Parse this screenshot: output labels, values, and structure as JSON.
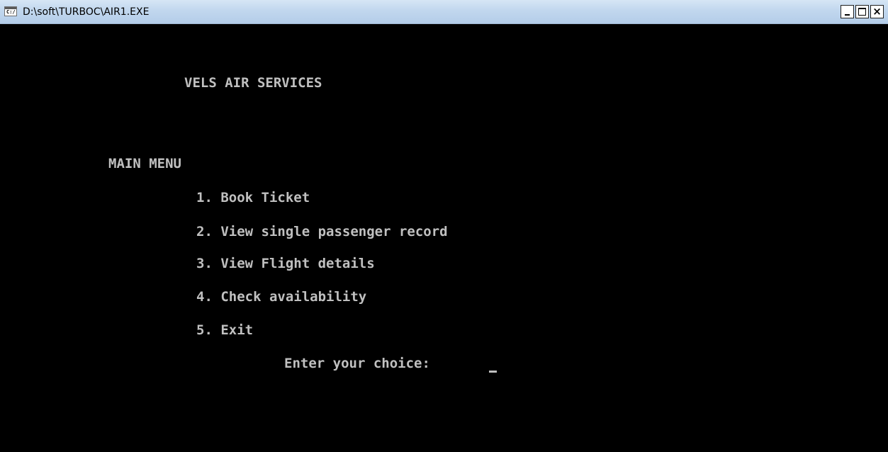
{
  "window": {
    "title": "D:\\soft\\TURBOC\\AIR1.EXE",
    "icon": "console-icon",
    "controls": {
      "minimize": "minimize-icon",
      "maximize": "maximize-icon",
      "close": "close-icon",
      "close_glyph": "×"
    }
  },
  "console": {
    "heading": "VELS AIR SERVICES",
    "menu_title": "MAIN MENU",
    "menu_items": [
      "1. Book Ticket",
      "2. View single passenger record",
      "3. View Flight details",
      "4. Check availability",
      "5. Exit"
    ],
    "prompt": "Enter your choice:",
    "text_color": "#c0c0c0",
    "background_color": "#000000"
  }
}
